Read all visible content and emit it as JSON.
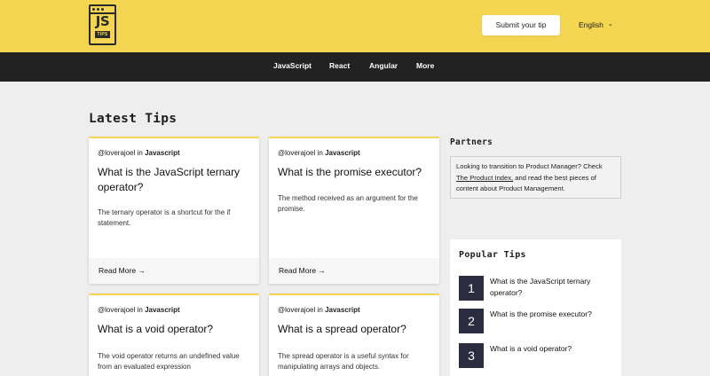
{
  "header": {
    "logo_text": "JS",
    "logo_tag": "TIPS",
    "submit_label": "Submit your tip",
    "language": "English",
    "colors": {
      "brand_yellow": "#f4d552",
      "nav_dark": "#222222",
      "number_badge": "#2c2c40"
    }
  },
  "nav": {
    "items": [
      "JavaScript",
      "React",
      "Angular",
      "More"
    ]
  },
  "main": {
    "section_title": "Latest Tips",
    "cards": [
      {
        "author": "@loverajoel",
        "in": "in",
        "category": "Javascript",
        "title": "What is the JavaScript ternary operator?",
        "description": "The ternary operator is a shortcut for the if statement.",
        "read_more": "Read More →"
      },
      {
        "author": "@loverajoel",
        "in": "in",
        "category": "Javascript",
        "title": "What is the promise executor?",
        "description": "The method received as an argument for the promise.",
        "read_more": "Read More →"
      },
      {
        "author": "@loverajoel",
        "in": "in",
        "category": "Javascript",
        "title": "What is a void operator?",
        "description": "The void operator returns an undefined value from an evaluated expression"
      },
      {
        "author": "@loverajoel",
        "in": "in",
        "category": "Javascript",
        "title": "What is a spread operator?",
        "description": "The spread operator is a useful syntax for manipulating arrays and objects."
      }
    ]
  },
  "sidebar": {
    "partners_title": "Partners",
    "partners_text_before": "Looking to transition to Product Manager? Check ",
    "partners_link": "The Product Index,",
    "partners_text_after": " and read the best pieces of content about Product Management.",
    "popular_title": "Popular Tips",
    "popular": [
      {
        "number": "1",
        "title": "What is the JavaScript ternary operator?"
      },
      {
        "number": "2",
        "title": "What is the promise executor?"
      },
      {
        "number": "3",
        "title": "What is a void operator?"
      }
    ]
  }
}
